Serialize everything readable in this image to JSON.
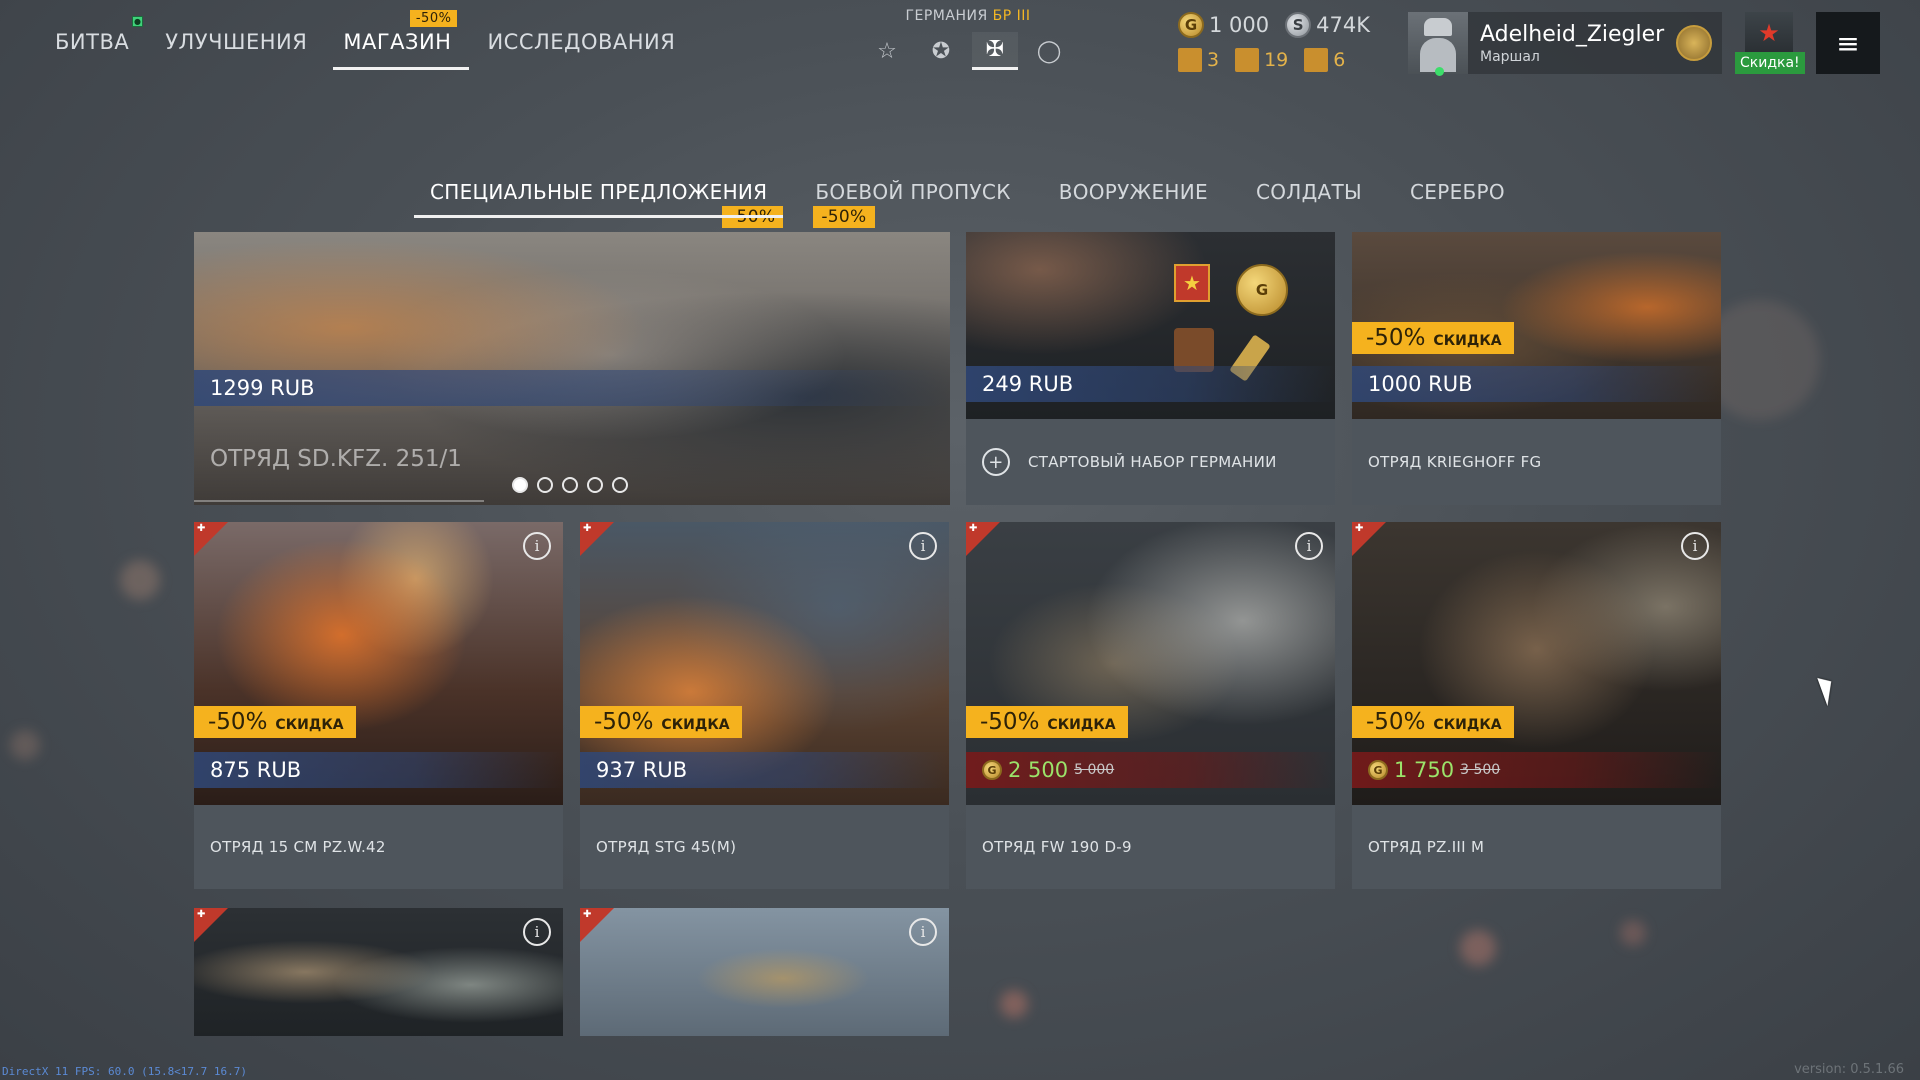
{
  "top_nav": {
    "items": [
      {
        "label": "БИТВА"
      },
      {
        "label": "УЛУЧШЕНИЯ"
      },
      {
        "label": "МАГАЗИН",
        "tag": "-50%"
      },
      {
        "label": "ИССЛЕДОВАНИЯ"
      }
    ],
    "active": "МАГАЗИН"
  },
  "nation": {
    "country": "ГЕРМАНИЯ",
    "br": "БР III",
    "icons": [
      "star-outline-icon",
      "star-circle-icon",
      "balkenkreuz-icon",
      "circle-icon"
    ]
  },
  "currency": {
    "gold": "1 000",
    "silver": "474K",
    "counts": [
      "3",
      "19",
      "6"
    ]
  },
  "profile": {
    "name": "Adelheid_Ziegler",
    "rank": "Маршал"
  },
  "promo": {
    "label": "Скидка!"
  },
  "shop_tabs": {
    "items": [
      {
        "label": "СПЕЦИАЛЬНЫЕ ПРЕДЛОЖЕНИЯ",
        "badge": "-50%"
      },
      {
        "label": "БОЕВОЙ ПРОПУСК",
        "badge": "-50%"
      },
      {
        "label": "ВООРУЖЕНИЕ"
      },
      {
        "label": "СОЛДАТЫ"
      },
      {
        "label": "СЕРЕБРО"
      }
    ]
  },
  "featured": {
    "price": "1299 RUB",
    "title": "ОТРЯД SD.KFZ. 251/1"
  },
  "cards": [
    {
      "price": "249 RUB",
      "caption": "СТАРТОВЫЙ НАБОР ГЕРМАНИИ"
    },
    {
      "discount": "-50%",
      "discount_label": "СКИДКА",
      "price": "1000 RUB",
      "caption": "ОТРЯД KRIEGHOFF FG"
    },
    {
      "discount": "-50%",
      "discount_label": "СКИДКА",
      "price": "875 RUB",
      "caption": "ОТРЯД 15 CM PZ.W.42"
    },
    {
      "discount": "-50%",
      "discount_label": "СКИДКА",
      "price": "937 RUB",
      "caption": "ОТРЯД STG 45(M)"
    },
    {
      "discount": "-50%",
      "discount_label": "СКИДКА",
      "price": "2 500",
      "old_price": "5 000",
      "caption": "ОТРЯД FW 190 D-9"
    },
    {
      "discount": "-50%",
      "discount_label": "СКИДКА",
      "price": "1 750",
      "old_price": "3 500",
      "caption": "ОТРЯД PZ.III M"
    }
  ],
  "colors": {
    "accent": "#f5b21e",
    "price_blue": "#30487a",
    "price_red": "#781a1a",
    "promo_green": "#2b9a3e"
  },
  "footer": {
    "fps": "DirectX 11 FPS: 60.0 (15.8<17.7 16.7)",
    "version": "version: 0.5.1.66"
  }
}
